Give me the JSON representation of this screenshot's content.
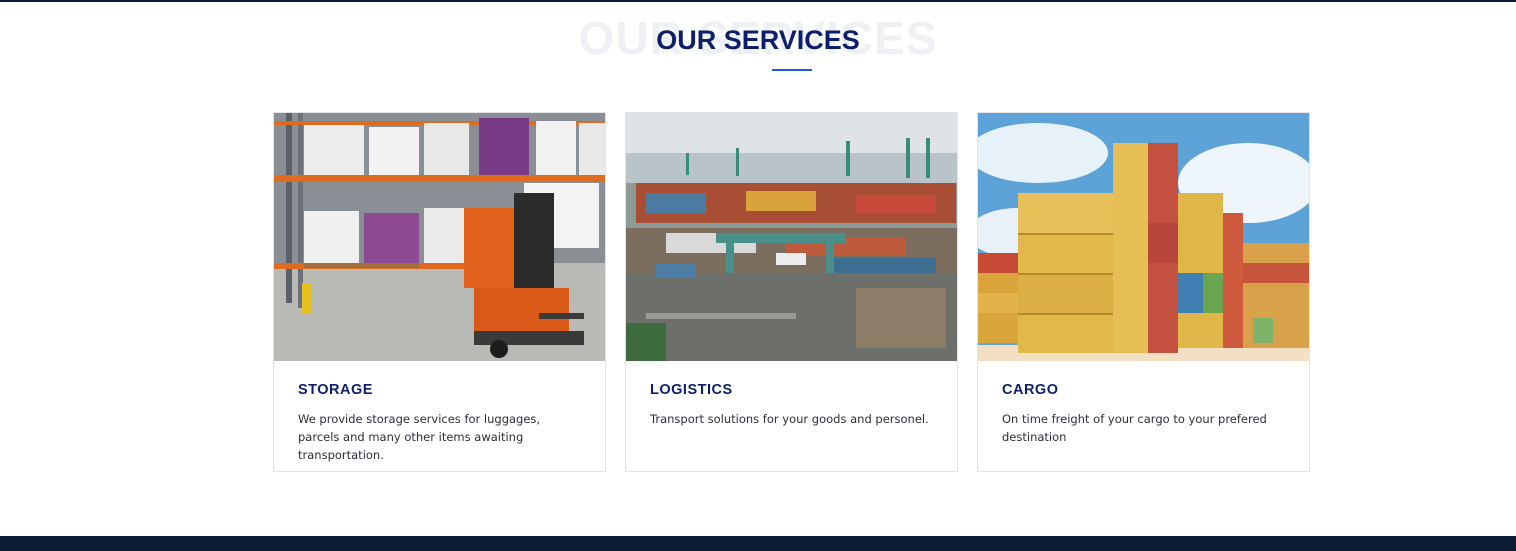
{
  "section": {
    "background_title": "OUR SERVICES",
    "title": "OUR SERVICES"
  },
  "services": [
    {
      "title": "STORAGE",
      "description": "We provide storage services for luggages, parcels and many other items awaiting transportation.",
      "image": "warehouse-forklift-photo"
    },
    {
      "title": "LOGISTICS",
      "description": "Transport solutions for your goods and personel.",
      "image": "container-port-aerial-photo"
    },
    {
      "title": "CARGO",
      "description": "On time freight of your cargo to your prefered destination",
      "image": "stacked-containers-photo"
    }
  ],
  "colors": {
    "title": "#0d1f6b",
    "accent": "#1f5bd6",
    "dark_navy": "#0c1a33"
  }
}
